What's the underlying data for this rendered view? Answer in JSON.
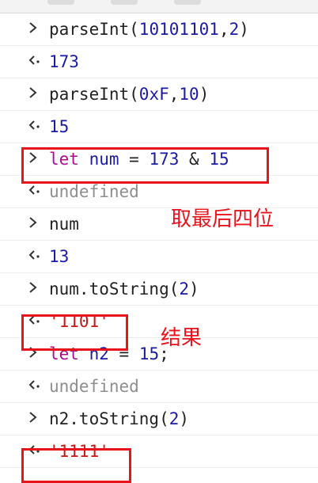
{
  "console": {
    "entries": [
      {
        "kind": "input",
        "tokens": [
          {
            "t": "fn",
            "v": "parseInt("
          },
          {
            "t": "num",
            "v": "10101101"
          },
          {
            "t": "op",
            "v": ","
          },
          {
            "t": "num",
            "v": "2"
          },
          {
            "t": "op",
            "v": ")"
          }
        ]
      },
      {
        "kind": "output",
        "tokens": [
          {
            "t": "num",
            "v": "173"
          }
        ]
      },
      {
        "kind": "input",
        "tokens": [
          {
            "t": "fn",
            "v": "parseInt("
          },
          {
            "t": "num",
            "v": "0xF"
          },
          {
            "t": "op",
            "v": ","
          },
          {
            "t": "num",
            "v": "10"
          },
          {
            "t": "op",
            "v": ")"
          }
        ]
      },
      {
        "kind": "output",
        "tokens": [
          {
            "t": "num",
            "v": "15"
          }
        ]
      },
      {
        "kind": "input",
        "tokens": [
          {
            "t": "kw",
            "v": "let"
          },
          {
            "t": "op",
            "v": " "
          },
          {
            "t": "num",
            "v": "num"
          },
          {
            "t": "op",
            "v": " = "
          },
          {
            "t": "num",
            "v": "173"
          },
          {
            "t": "op",
            "v": " & "
          },
          {
            "t": "num",
            "v": "15"
          }
        ]
      },
      {
        "kind": "output",
        "tokens": [
          {
            "t": "undef",
            "v": "undefined"
          }
        ]
      },
      {
        "kind": "input",
        "tokens": [
          {
            "t": "fn",
            "v": "num"
          }
        ]
      },
      {
        "kind": "output",
        "tokens": [
          {
            "t": "num",
            "v": "13"
          }
        ]
      },
      {
        "kind": "input",
        "tokens": [
          {
            "t": "fn",
            "v": "num.toString("
          },
          {
            "t": "num",
            "v": "2"
          },
          {
            "t": "op",
            "v": ")"
          }
        ]
      },
      {
        "kind": "output",
        "tokens": [
          {
            "t": "str",
            "v": "'1101'"
          }
        ]
      },
      {
        "kind": "input",
        "tokens": [
          {
            "t": "kw",
            "v": "let"
          },
          {
            "t": "op",
            "v": " "
          },
          {
            "t": "num",
            "v": "n2"
          },
          {
            "t": "op",
            "v": " = "
          },
          {
            "t": "num",
            "v": "15"
          },
          {
            "t": "op",
            "v": ";"
          }
        ]
      },
      {
        "kind": "output",
        "tokens": [
          {
            "t": "undef",
            "v": "undefined"
          }
        ]
      },
      {
        "kind": "input",
        "tokens": [
          {
            "t": "fn",
            "v": "n2.toString("
          },
          {
            "t": "num",
            "v": "2"
          },
          {
            "t": "op",
            "v": ")"
          }
        ]
      },
      {
        "kind": "output",
        "tokens": [
          {
            "t": "str",
            "v": "'1111'"
          }
        ]
      }
    ]
  },
  "annotations": {
    "note_last_four_bits": "取最后四位",
    "note_result": "结果"
  },
  "icons": {
    "input_prompt": "chevron-right-icon",
    "output_prompt": "return-arrow-icon"
  },
  "colors": {
    "highlight_box": "#e8141c",
    "number": "#1a1aa6",
    "keyword": "#aa0d91",
    "string": "#c41a16",
    "undefined": "#8e8e8e"
  }
}
